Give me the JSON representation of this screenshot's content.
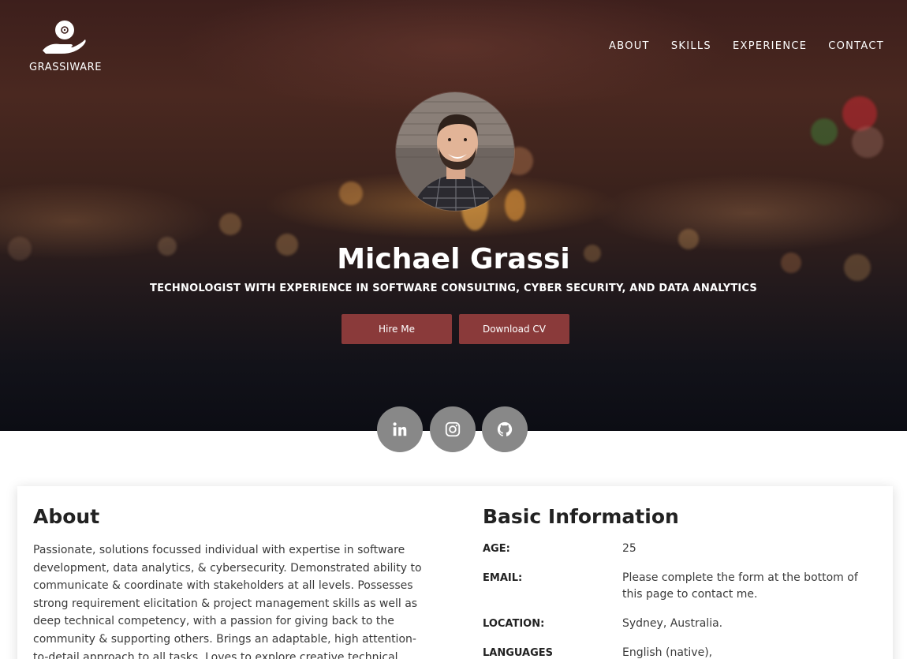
{
  "brand": {
    "name": "GRASSIWARE",
    "logo_icon": "hand-holding-disc-icon"
  },
  "nav": {
    "items": [
      {
        "label": "ABOUT"
      },
      {
        "label": "SKILLS"
      },
      {
        "label": "EXPERIENCE"
      },
      {
        "label": "CONTACT"
      }
    ]
  },
  "hero": {
    "name": "Michael Grassi",
    "tagline": "TECHNOLOGIST WITH EXPERIENCE IN SOFTWARE CONSULTING, CYBER SECURITY, AND DATA ANALYTICS",
    "hire_label": "Hire Me",
    "cv_label": "Download CV",
    "button_color": "#8a3a3a"
  },
  "social": [
    {
      "name": "linkedin-icon"
    },
    {
      "name": "instagram-icon"
    },
    {
      "name": "github-icon"
    }
  ],
  "about": {
    "title": "About",
    "text": "Passionate, solutions focussed individual with expertise in software development, data analytics, & cybersecurity. Demonstrated ability to communicate & coordinate with stakeholders at all levels. Possesses strong requirement elicitation & project management skills as well as deep technical competency, with a passion for giving back to the community & supporting others. Brings an adaptable, high attention-to-detail approach to all tasks. Loves to explore creative technical"
  },
  "basic_info": {
    "title": "Basic Information",
    "rows": [
      {
        "label": "AGE:",
        "value": "25"
      },
      {
        "label": "EMAIL:",
        "value": "Please complete the form at the bottom of this page to contact me."
      },
      {
        "label": "LOCATION:",
        "value": "Sydney, Australia."
      },
      {
        "label": "LANGUAGES",
        "value": "English (native),"
      }
    ]
  }
}
